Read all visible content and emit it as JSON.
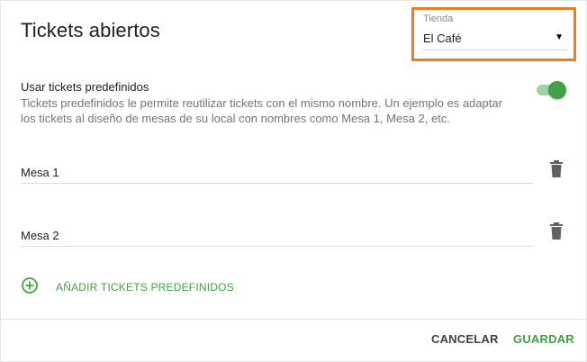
{
  "dialog": {
    "title": "Tickets abiertos"
  },
  "store": {
    "label": "Tienda",
    "value": "El Café",
    "highlight_color": "#f07c1e"
  },
  "predefined": {
    "title": "Usar tickets predefinidos",
    "description": "Tickets predefinidos le permite reutilizar tickets con el mismo nombre. Un ejemplo es adaptar los tickets al diseño de mesas de su local con nombres como Mesa 1, Mesa 2, etc.",
    "enabled": true
  },
  "tickets": [
    {
      "name": "Mesa 1"
    },
    {
      "name": "Mesa 2"
    }
  ],
  "add_ticket": {
    "label": "AÑADIR TICKETS PREDEFINIDOS",
    "icon": "add-circle-icon"
  },
  "actions": {
    "cancel_label": "CANCELAR",
    "save_label": "GUARDAR"
  },
  "colors": {
    "accent": "#43a047",
    "toggle_track": "#9fd3a6"
  }
}
